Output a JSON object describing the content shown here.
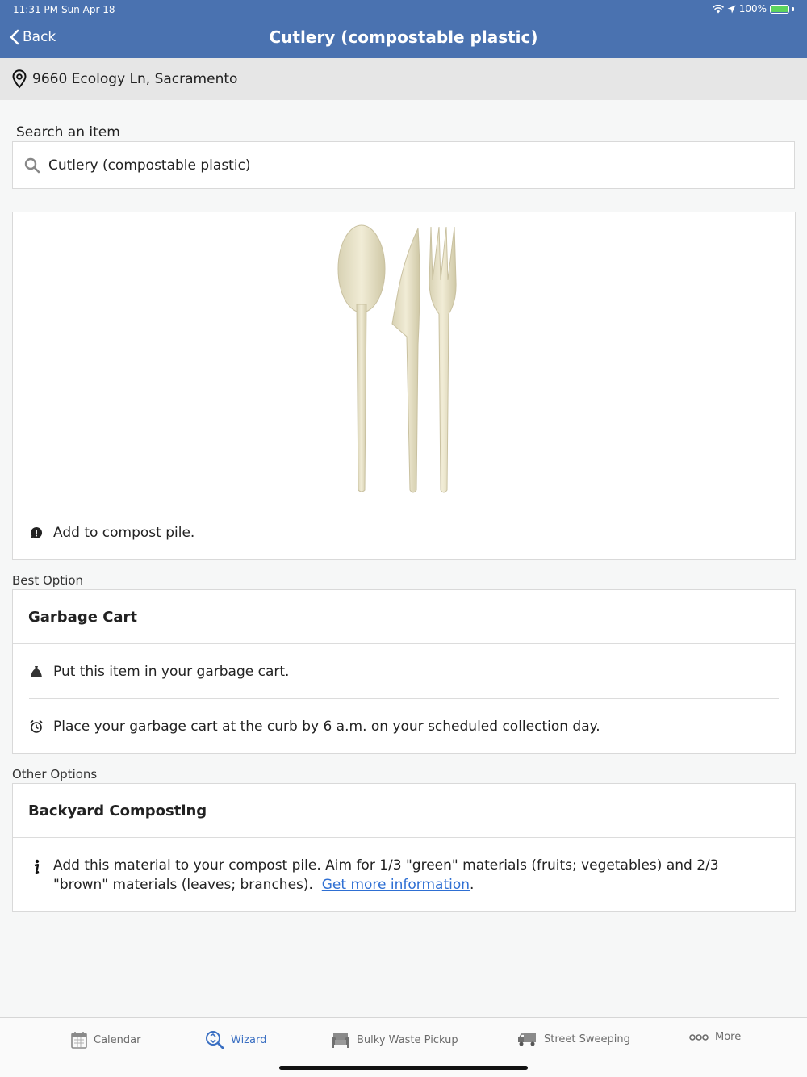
{
  "status": {
    "time": "11:31 PM",
    "date": "Sun Apr 18",
    "battery": "100%"
  },
  "nav": {
    "back_label": "Back",
    "title": "Cutlery (compostable plastic)"
  },
  "address": {
    "text": "9660 Ecology Ln, Sacramento"
  },
  "search": {
    "label": "Search an item",
    "value": "Cutlery (compostable plastic)"
  },
  "item": {
    "note": "Add to compost pile."
  },
  "best_option": {
    "section_label": "Best Option",
    "title": "Garbage Cart",
    "lines": [
      "Put this item in your garbage cart.",
      "Place your garbage cart at the curb by 6 a.m. on your scheduled collection day."
    ]
  },
  "other_options": {
    "section_label": "Other Options",
    "title": "Backyard Composting",
    "text": "Add this material to your compost pile. Aim for 1/3 \"green\" materials (fruits; vegetables) and 2/3 \"brown\" materials (leaves; branches).",
    "link": "Get more information",
    "trailing": "."
  },
  "tabs": [
    {
      "label": "Calendar",
      "icon": "calendar-icon",
      "active": false
    },
    {
      "label": "Wizard",
      "icon": "recycle-search-icon",
      "active": true
    },
    {
      "label": "Bulky Waste Pickup",
      "icon": "sofa-icon",
      "active": false
    },
    {
      "label": "Street Sweeping",
      "icon": "sweeper-truck-icon",
      "active": false
    },
    {
      "label": "More",
      "icon": "more-dots-icon",
      "active": false
    }
  ],
  "colors": {
    "header": "#4a72b0",
    "accent": "#3a6fc2",
    "link": "#2e6fd3"
  }
}
